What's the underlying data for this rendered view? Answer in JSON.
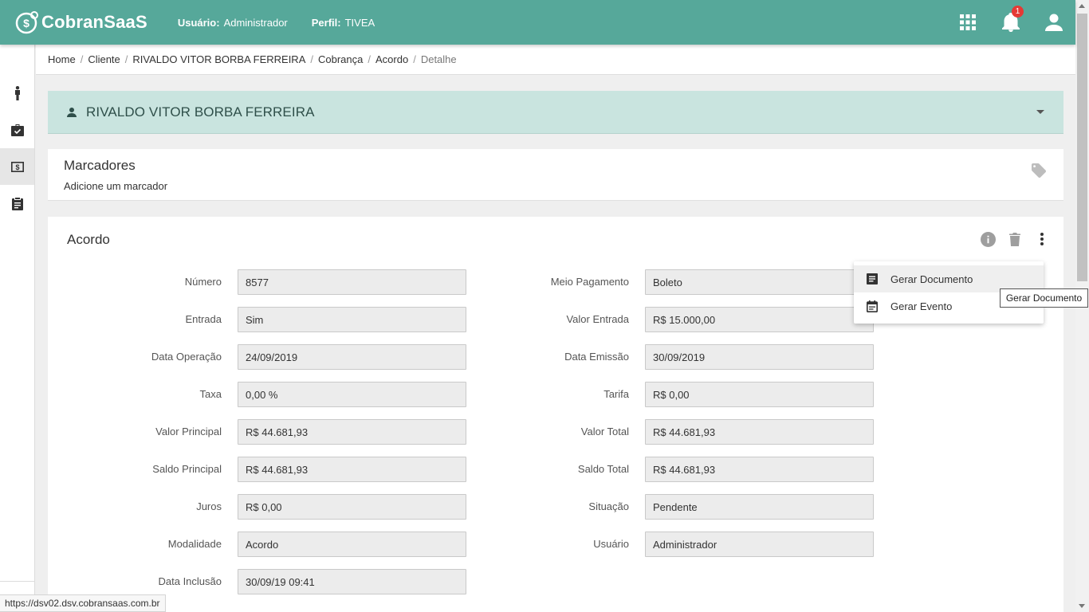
{
  "header": {
    "logo_text": "CobranSaaS",
    "user_label": "Usuário:",
    "user_value": "Administrador",
    "profile_label": "Perfil:",
    "profile_value": "TIVEA",
    "notification_count": "1",
    "color": "#56a89a"
  },
  "sidebar": {
    "items": [
      {
        "icon": "person-icon"
      },
      {
        "icon": "briefcase-icon"
      },
      {
        "icon": "money-icon",
        "active": true
      },
      {
        "icon": "clipboard-icon"
      }
    ]
  },
  "breadcrumb": [
    "Home",
    "Cliente",
    "RIVALDO VITOR BORBA FERREIRA",
    "Cobrança",
    "Acordo",
    "Detalhe"
  ],
  "client": {
    "name": "RIVALDO VITOR BORBA FERREIRA"
  },
  "tags": {
    "title": "Marcadores",
    "add_label": "Adicione um marcador"
  },
  "agreement": {
    "title": "Acordo",
    "left_fields": [
      {
        "label": "Número",
        "value": "8577"
      },
      {
        "label": "Entrada",
        "value": "Sim"
      },
      {
        "label": "Data Operação",
        "value": "24/09/2019"
      },
      {
        "label": "Taxa",
        "value": "0,00 %"
      },
      {
        "label": "Valor Principal",
        "value": "R$ 44.681,93"
      },
      {
        "label": "Saldo Principal",
        "value": "R$ 44.681,93"
      },
      {
        "label": "Juros",
        "value": "R$ 0,00"
      },
      {
        "label": "Modalidade",
        "value": "Acordo"
      },
      {
        "label": "Data Inclusão",
        "value": "30/09/19 09:41"
      }
    ],
    "right_fields": [
      {
        "label": "Meio Pagamento",
        "value": "Boleto"
      },
      {
        "label": "Valor Entrada",
        "value": "R$ 15.000,00"
      },
      {
        "label": "Data Emissão",
        "value": "30/09/2019"
      },
      {
        "label": "Tarifa",
        "value": "R$ 0,00"
      },
      {
        "label": "Valor Total",
        "value": "R$ 44.681,93"
      },
      {
        "label": "Saldo Total",
        "value": "R$ 44.681,93"
      },
      {
        "label": "Situação",
        "value": "Pendente"
      },
      {
        "label": "Usuário",
        "value": "Administrador"
      }
    ]
  },
  "menu": {
    "items": [
      {
        "label": "Gerar Documento",
        "icon": "document-icon"
      },
      {
        "label": "Gerar Evento",
        "icon": "event-icon"
      }
    ]
  },
  "tooltip": "Gerar Documento",
  "status_url": "https://dsv02.dsv.cobransaas.com.br"
}
